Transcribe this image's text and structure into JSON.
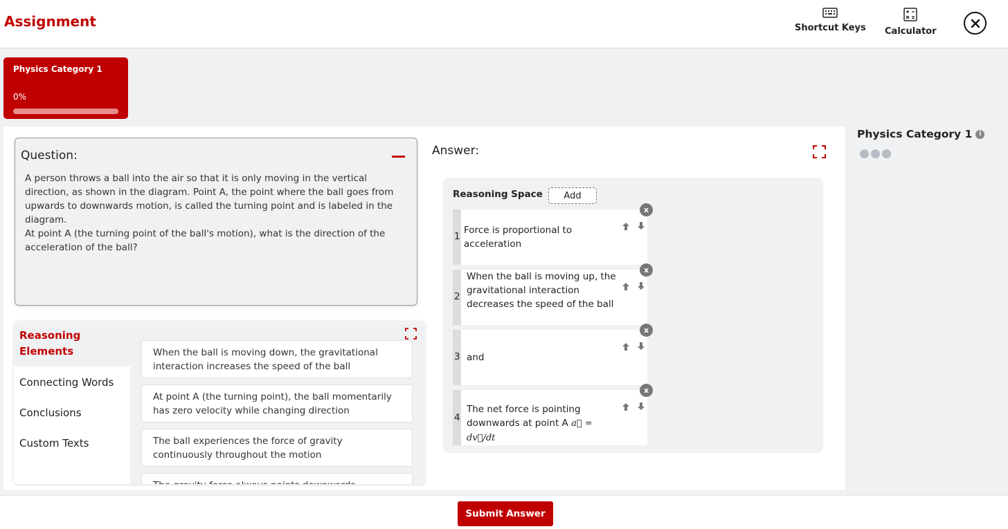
{
  "header": {
    "title": "Assignment",
    "tools": [
      {
        "label": "Shortcut Keys",
        "icon": "keyboard-icon"
      },
      {
        "label": "Calculator",
        "icon": "calculator-icon"
      }
    ],
    "close_icon": "close-icon"
  },
  "category_card": {
    "title": "Physics Category 1",
    "progress_label": "0%",
    "progress": 0
  },
  "question": {
    "title": "Question:",
    "lines": [
      "A person throws a ball into the air so that it is only moving in the vertical direction, as shown in the diagram. Point A, the point where the ball goes from upwards to downwards motion, is called the turning point and is labeled in the diagram.",
      "At point A (the turning point of the ball's motion), what is the direction of the acceleration of the ball?"
    ]
  },
  "reasoning_elements": {
    "title": "Reasoning Elements",
    "tabs": [
      "Connecting Words",
      "Conclusions",
      "Custom Texts"
    ],
    "cards": [
      "When the ball is moving down, the gravitational interaction increases the speed of the ball",
      "At point A (the turning point), the ball momentarily has zero velocity while changing direction",
      "The ball experiences the force of gravity continuously throughout the motion",
      "The gravity force always points downwards"
    ]
  },
  "answer": {
    "title": "Answer:",
    "reasoning_space_title": "Reasoning Space",
    "add_label": "Add",
    "steps": [
      {
        "num": "1",
        "text": "Force is proportional to acceleration"
      },
      {
        "num": "2",
        "text": "When the ball is moving up, the gravitational interaction decreases the speed of the ball"
      },
      {
        "num": "3",
        "text": "and"
      },
      {
        "num": "4",
        "text": "The net force is pointing downwards at point A",
        "math": "a⃗ = dv⃗/dt"
      }
    ],
    "remove_label": "x"
  },
  "sidebar": {
    "title": "Physics Category 1",
    "info_icon": "info-icon"
  },
  "footer": {
    "submit_label": "Submit Answer"
  },
  "colors": {
    "brand_red": "#c00000",
    "panel_gray": "#f0f1f3"
  }
}
